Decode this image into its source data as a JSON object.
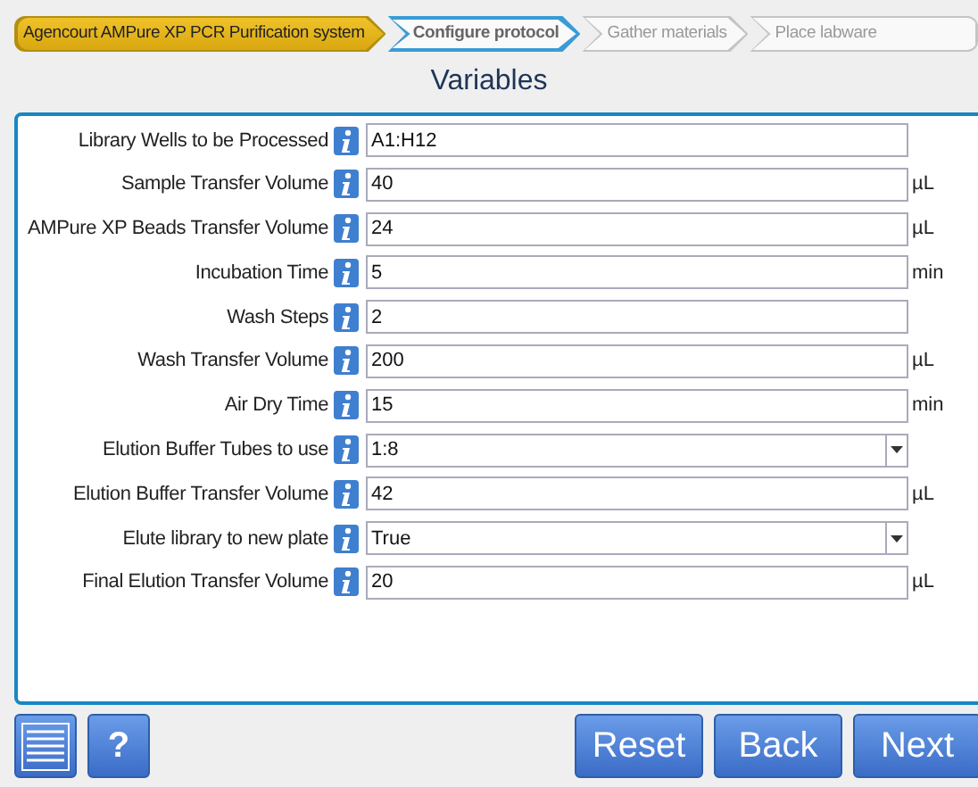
{
  "steps": [
    {
      "label": "Agencourt AMPure XP PCR Purification system",
      "done": true,
      "selected": false
    },
    {
      "label": "Configure protocol",
      "done": false,
      "selected": true
    },
    {
      "label": "Gather materials",
      "done": false,
      "selected": false
    },
    {
      "label": "Place labware",
      "done": false,
      "selected": false
    }
  ],
  "title": "Variables",
  "variables": [
    {
      "label": "Library Wells to be Processed",
      "kind": "text",
      "value": "A1:H12"
    },
    {
      "label": "Sample Transfer Volume",
      "kind": "text",
      "value": "40",
      "unit": "µL"
    },
    {
      "label": "AMPure XP Beads Transfer Volume",
      "kind": "text",
      "value": "24",
      "unit": "µL"
    },
    {
      "label": "Incubation Time",
      "kind": "text",
      "value": "5",
      "unit": "min"
    },
    {
      "label": "Wash Steps",
      "kind": "text",
      "value": "2"
    },
    {
      "label": "Wash Transfer Volume",
      "kind": "text",
      "value": "200",
      "unit": "µL"
    },
    {
      "label": "Air Dry Time",
      "kind": "text",
      "value": "15",
      "unit": "min"
    },
    {
      "label": "Elution Buffer Tubes to use",
      "kind": "select",
      "value": "1:8"
    },
    {
      "label": "Elution Buffer Transfer Volume",
      "kind": "text",
      "value": "42",
      "unit": "µL"
    },
    {
      "label": "Elute library to new plate",
      "kind": "select",
      "value": "True"
    },
    {
      "label": "Final Elution Transfer Volume",
      "kind": "text",
      "value": "20",
      "unit": "µL"
    }
  ],
  "help_button": "?",
  "buttons": [
    "Reset",
    "Back",
    "Next"
  ]
}
